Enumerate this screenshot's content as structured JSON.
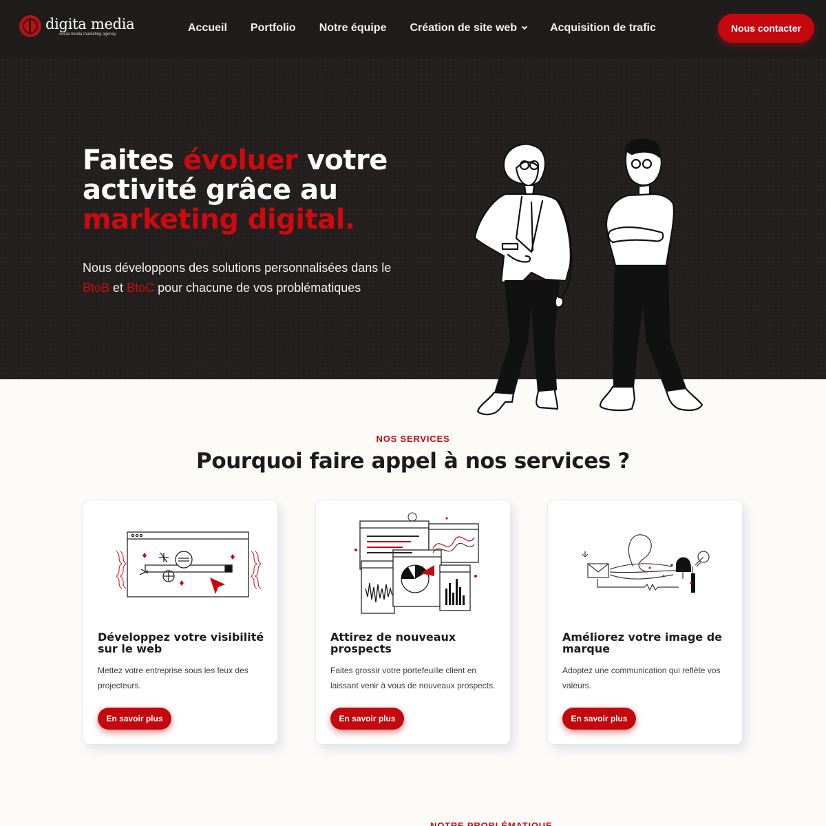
{
  "brand": {
    "name": "digita media",
    "tagline": "social media marketing agency",
    "accent": "#c4080e",
    "dark": "#231f1e"
  },
  "nav": {
    "items": [
      {
        "label": "Accueil"
      },
      {
        "label": "Portfolio"
      },
      {
        "label": "Notre équipe"
      },
      {
        "label": "Création de site web",
        "has_dropdown": true
      },
      {
        "label": "Acquisition de trafic"
      }
    ],
    "cta_label": "Nous contacter"
  },
  "hero": {
    "title_part1": "Faites ",
    "title_highlight1": "évoluer",
    "title_part2": " votre activité grâce au ",
    "title_highlight2": "marketing digital.",
    "subtitle_part1": "Nous développons des solutions personnalisées dans le ",
    "subtitle_btob": "BtoB",
    "subtitle_mid": " et ",
    "subtitle_btoc": "BtoC",
    "subtitle_part2": " pour chacune de vos problématiques"
  },
  "services": {
    "eyebrow": "NOS SERVICES",
    "title": "Pourquoi faire appel à nos services ?",
    "cards": [
      {
        "title": "Développez votre visibilité sur le web",
        "description": "Mettez votre entreprise sous les feux des projecteurs.",
        "button": "En savoir plus",
        "icon": "browser-search-icon"
      },
      {
        "title": "Attirez de nouveaux prospects",
        "description": "Faites grossir votre portefeuille client en laissant venir à vous de nouveaux prospects.",
        "button": "En savoir plus",
        "icon": "analytics-windows-icon"
      },
      {
        "title": "Améliorez votre image de marque",
        "description": "Adoptez une communication qui reflète vos valeurs.",
        "button": "En savoir plus",
        "icon": "mail-flow-icon"
      }
    ]
  },
  "next_section": {
    "eyebrow": "NOTRE PROBLÉMATIQUE"
  }
}
